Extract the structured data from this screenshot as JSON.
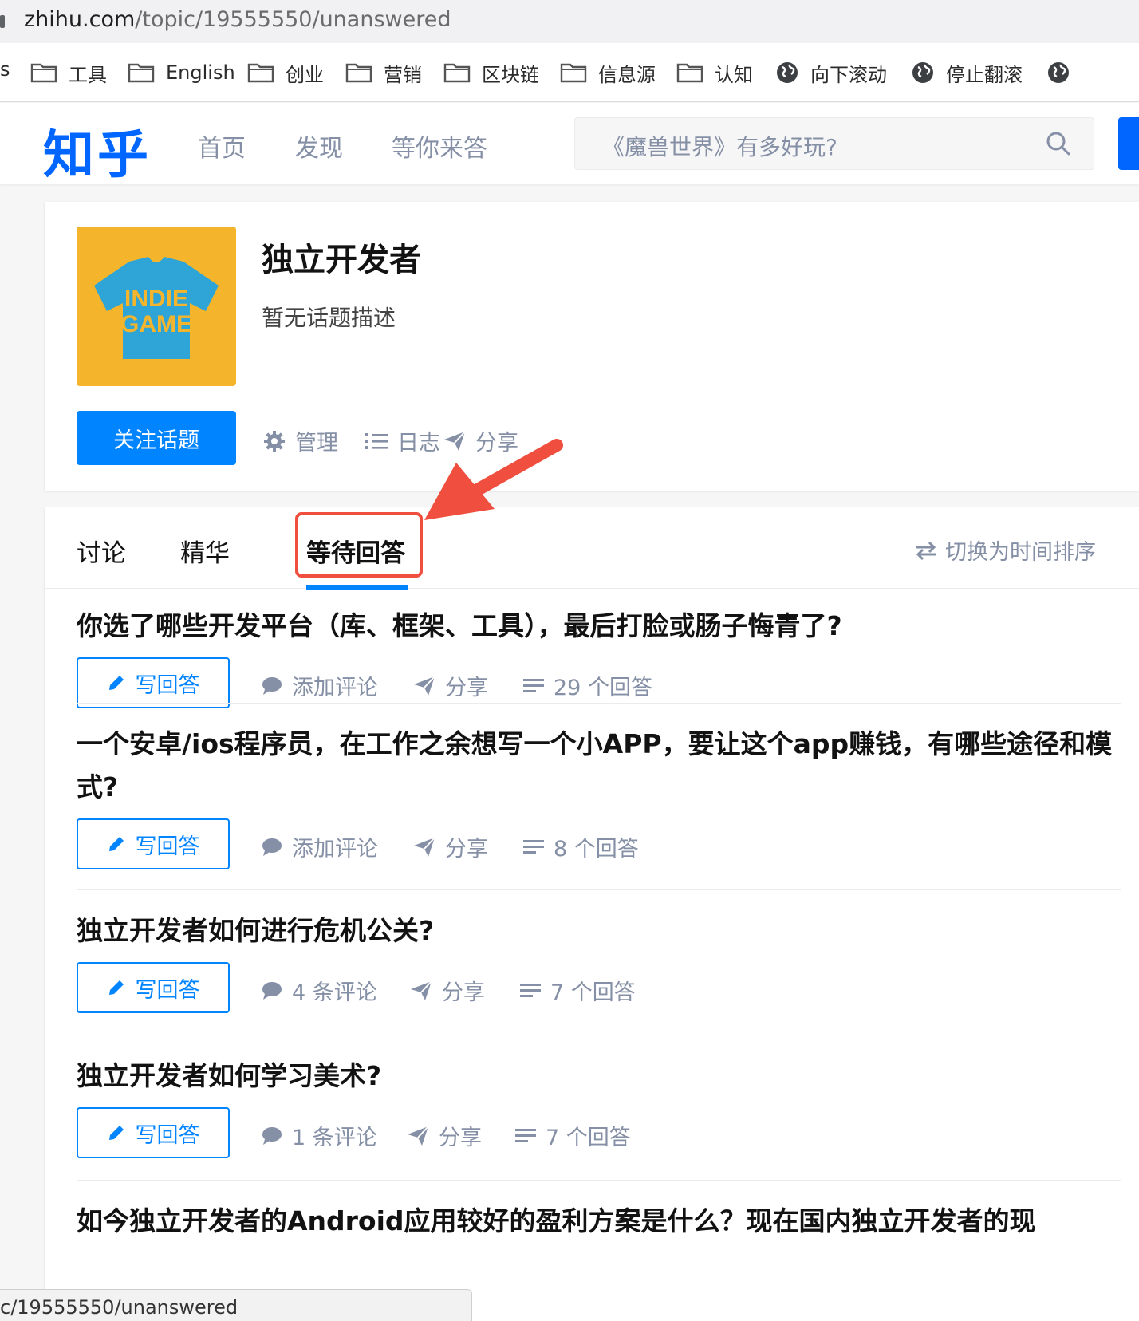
{
  "browser": {
    "url_host": "zhihu.com",
    "url_path": "/topic/19555550/unanswered",
    "status_url": "c/19555550/unanswered"
  },
  "bookmarks": {
    "partial_left": "s",
    "items": [
      {
        "label": "工具",
        "icon": "folder-icon"
      },
      {
        "label": "English",
        "icon": "folder-icon"
      },
      {
        "label": "创业",
        "icon": "folder-icon"
      },
      {
        "label": "营销",
        "icon": "folder-icon"
      },
      {
        "label": "区块链",
        "icon": "folder-icon"
      },
      {
        "label": "信息源",
        "icon": "folder-icon"
      },
      {
        "label": "认知",
        "icon": "folder-icon"
      },
      {
        "label": "向下滚动",
        "icon": "globe-icon"
      },
      {
        "label": "停止翻滚",
        "icon": "globe-icon"
      }
    ]
  },
  "header": {
    "logo": "知乎",
    "nav": [
      "首页",
      "发现",
      "等你来答"
    ],
    "search_placeholder": "《魔兽世界》有多好玩?"
  },
  "topic": {
    "image_text_line1": "INDIE",
    "image_text_line2": "GAME",
    "title": "独立开发者",
    "description": "暂无话题描述",
    "follow_label": "关注话题",
    "actions": {
      "manage": "管理",
      "log": "日志",
      "share": "分享"
    }
  },
  "tabs": {
    "items": [
      "讨论",
      "精华",
      "等待回答"
    ],
    "active": "等待回答",
    "sort_label": "切换为时间排序"
  },
  "questions": [
    {
      "title": "你选了哪些开发平台（库、框架、工具），最后打脸或肠子悔青了?",
      "write": "写回答",
      "comment": "添加评论",
      "share": "分享",
      "answers": "29 个回答"
    },
    {
      "title": "一个安卓/ios程序员，在工作之余想写一个小APP，要让这个app赚钱，有哪些途径和模式?",
      "write": "写回答",
      "comment": "添加评论",
      "share": "分享",
      "answers": "8 个回答"
    },
    {
      "title": "独立开发者如何进行危机公关?",
      "write": "写回答",
      "comment": "4 条评论",
      "share": "分享",
      "answers": "7 个回答"
    },
    {
      "title": "独立开发者如何学习美术?",
      "write": "写回答",
      "comment": "1 条评论",
      "share": "分享",
      "answers": "7 个回答"
    },
    {
      "title": "如今独立开发者的Android应用较好的盈利方案是什么？现在国内独立开发者的现"
    }
  ],
  "colors": {
    "brand": "#0066ff",
    "primary_button": "#0084ff",
    "muted_text": "#8590a6",
    "annotation_red": "#f04e3e",
    "topic_image_bg": "#f4b52d",
    "tshirt": "#2ea5d6"
  }
}
